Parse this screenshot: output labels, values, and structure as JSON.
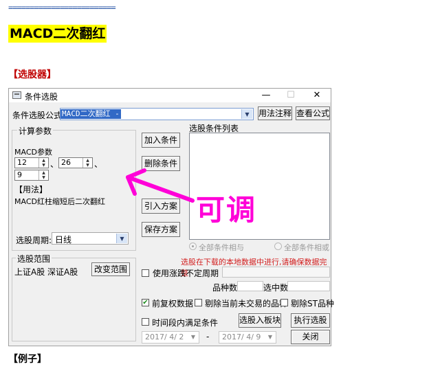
{
  "article": {
    "separator": "=========================",
    "title": "MACD二次翻红",
    "selector_heading": "【选股器】",
    "example_heading": "【例子】",
    "annotation": "可调"
  },
  "dialog": {
    "title": "条件选股",
    "titlebar_buttons": {
      "minimize": "—",
      "maximize": "☐",
      "close": "✕"
    },
    "formula_label": "条件选股公式",
    "formula_value": "MACD二次翻红 -",
    "usage_button": "用法注释",
    "view_formula_button": "查看公式",
    "params_group": "计算参数",
    "params_name": "MACD参数",
    "params": {
      "p1": "12",
      "p2": "26",
      "p3": "9",
      "sep1": "、",
      "sep2": "、"
    },
    "usage_heading": "【用法】",
    "usage_text": "MACD红柱缩短后二次翻红",
    "period_label": "选股周期:",
    "period_value": "日线",
    "add_condition": "加入条件",
    "delete_condition": "删除条件",
    "import_scheme": "引入方案",
    "save_scheme": "保存方案",
    "condition_list_label": "选股条件列表",
    "radio_and": "全部条件相与",
    "radio_or": "全部条件相或",
    "warning": "选股在下载的本地数据中进行,请确保数据完整",
    "range_group": "选股范围",
    "range_value": "上证A股 深证A股",
    "change_range": "改变范围",
    "chk_uncertain_period": "使用涨跌不定周期",
    "count_label": "品种数",
    "selected_label": "选中数",
    "chk_adjusted": "前复权数据",
    "chk_exclude_untraded": "剔除当前未交易的品种",
    "chk_exclude_st": "剔除ST品种",
    "chk_time_range": "时间段内满足条件",
    "select_to_block": "选股入板块",
    "execute": "执行选股",
    "close": "关闭",
    "date_from": "2017/ 4/ 2",
    "date_to": "2017/ 4/ 9",
    "date_dash": "-"
  },
  "colors": {
    "highlight": "#ffff00",
    "accent_red": "#c00000",
    "annotation": "#ff00d8",
    "selection": "#3169c6"
  }
}
